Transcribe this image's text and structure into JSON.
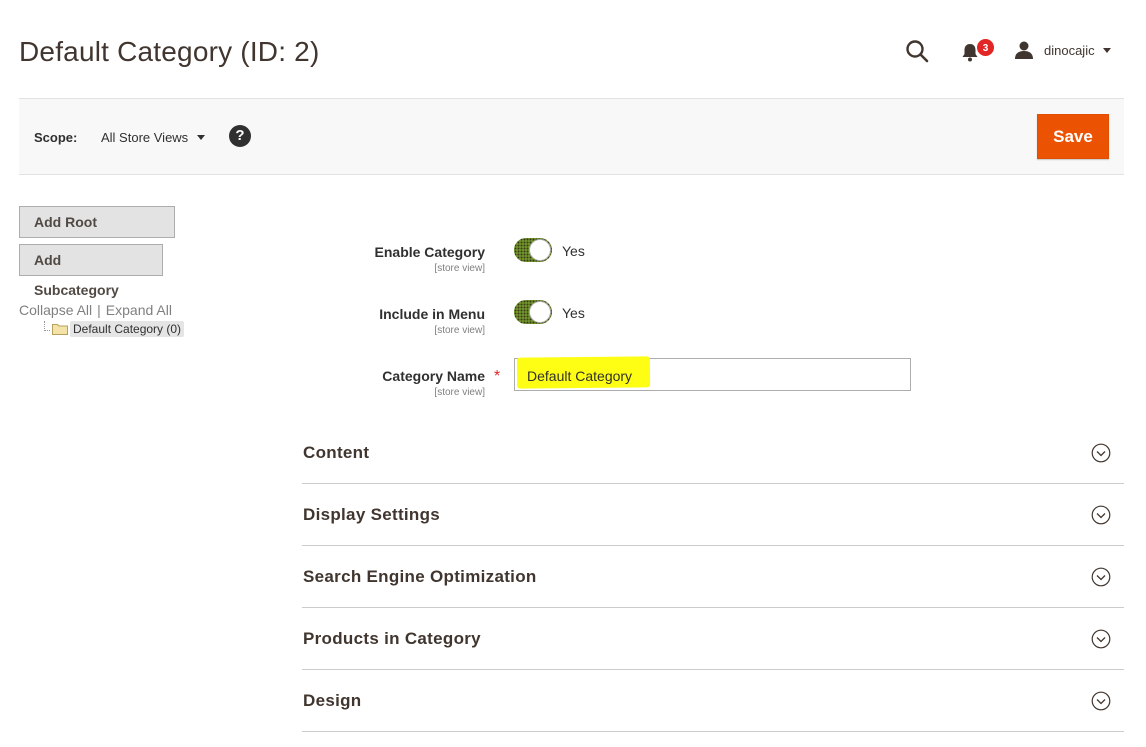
{
  "header": {
    "page_title": "Default Category (ID: 2)",
    "notifications_count": "3",
    "username": "dinocajic"
  },
  "scope_bar": {
    "scope_label": "Scope:",
    "scope_value": "All Store Views",
    "help_glyph": "?",
    "save_label": "Save"
  },
  "sidebar": {
    "add_root_label": "Add Root Category",
    "add_sub_label": "Add Subcategory",
    "collapse_all": "Collapse All",
    "separator": "|",
    "expand_all": "Expand All",
    "tree": [
      {
        "label": "Default Category (0)"
      }
    ]
  },
  "form": {
    "enable_category": {
      "label": "Enable Category",
      "scope": "[store view]",
      "value": "Yes"
    },
    "include_in_menu": {
      "label": "Include in Menu",
      "scope": "[store view]",
      "value": "Yes"
    },
    "category_name": {
      "label": "Category Name",
      "scope": "[store view]",
      "required": "*",
      "value": "Default Category"
    }
  },
  "sections": [
    {
      "title": "Content"
    },
    {
      "title": "Display Settings"
    },
    {
      "title": "Search Engine Optimization"
    },
    {
      "title": "Products in Category"
    },
    {
      "title": "Design"
    }
  ],
  "colors": {
    "primary_button": "#eb5202",
    "toggle_on": "#79a22e",
    "highlight": "#fefe14",
    "badge": "#e22626"
  },
  "icons": [
    "search-icon",
    "bell-icon",
    "user-icon",
    "chevron-down-icon",
    "help-icon",
    "folder-icon",
    "circle-chevron-down-icon"
  ]
}
